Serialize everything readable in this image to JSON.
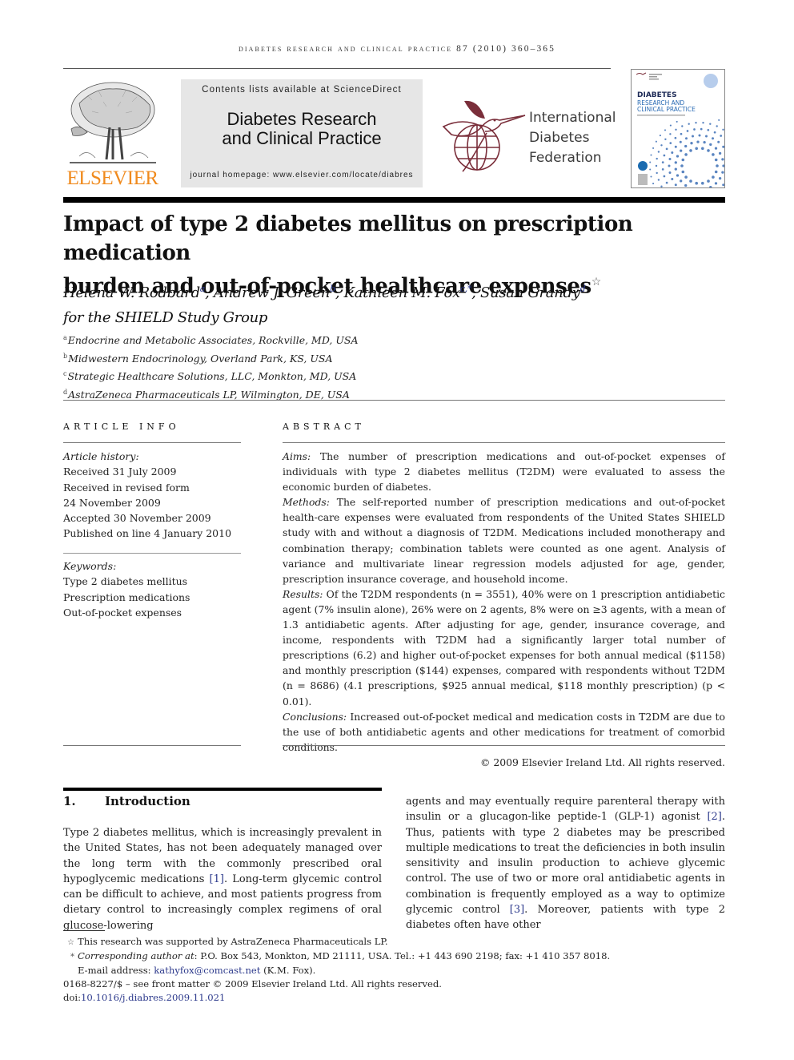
{
  "running_head": "DIABETES RESEARCH AND CLINICAL PRACTICE 87 (2010) 360–365",
  "masthead": {
    "publisher_logo_text": "ELSEVIER",
    "contents_line": "Contents lists available at ScienceDirect",
    "journal_title_line1": "Diabetes Research",
    "journal_title_line2": "and Clinical Practice",
    "homepage_line": "journal homepage: www.elsevier.com/locate/diabres",
    "idf_line1": "International",
    "idf_line2": "Diabetes",
    "idf_line3": "Federation",
    "cover_title": "DIABETES",
    "cover_sub1": "RESEARCH AND",
    "cover_sub2": "CLINICAL PRACTICE"
  },
  "article": {
    "title_line1": "Impact of type 2 diabetes mellitus on prescription medication",
    "title_line2": "burden and out-of-pocket healthcare expenses",
    "title_mark": "☆",
    "authors": [
      {
        "name": "Helena W. Rodbard",
        "sup": "a"
      },
      {
        "name": "Andrew J. Green",
        "sup": "b"
      },
      {
        "name": "Kathleen M. Fox",
        "sup": "c,*"
      },
      {
        "name": "Susan Grandy",
        "sup": "d"
      }
    ],
    "group": "for the SHIELD Study Group",
    "affiliations": [
      {
        "sup": "a",
        "text": "Endocrine and Metabolic Associates, Rockville, MD, USA"
      },
      {
        "sup": "b",
        "text": "Midwestern Endocrinology, Overland Park, KS, USA"
      },
      {
        "sup": "c",
        "text": "Strategic Healthcare Solutions, LLC, Monkton, MD, USA"
      },
      {
        "sup": "d",
        "text": "AstraZeneca Pharmaceuticals LP, Wilmington, DE, USA"
      }
    ]
  },
  "article_info": {
    "heading": "ARTICLE INFO",
    "history_label": "Article history:",
    "history": [
      "Received 31 July 2009",
      "Received in revised form",
      "24 November 2009",
      "Accepted 30 November 2009",
      "Published on line 4 January 2010"
    ],
    "keywords_label": "Keywords:",
    "keywords": [
      "Type 2 diabetes mellitus",
      "Prescription medications",
      "Out-of-pocket expenses"
    ]
  },
  "abstract": {
    "heading": "ABSTRACT",
    "aims_label": "Aims:",
    "aims": "The number of prescription medications and out-of-pocket expenses of individuals with type 2 diabetes mellitus (T2DM) were evaluated to assess the economic burden of diabetes.",
    "methods_label": "Methods:",
    "methods": "The self-reported number of prescription medications and out-of-pocket health-care expenses were evaluated from respondents of the United States SHIELD study with and without a diagnosis of T2DM. Medications included monotherapy and combination therapy; combination tablets were counted as one agent. Analysis of variance and multivariate linear regression models adjusted for age, gender, prescription insurance coverage, and household income.",
    "results_label": "Results:",
    "results": "Of the T2DM respondents (n = 3551), 40% were on 1 prescription antidiabetic agent (7% insulin alone), 26% were on 2 agents, 8% were on ≥3 agents, with a mean of 1.3 antidiabetic agents. After adjusting for age, gender, insurance coverage, and income, respondents with T2DM had a significantly larger total number of prescriptions (6.2) and higher out-of-pocket expenses for both annual medical ($1158) and monthly prescription ($144) expenses, compared with respondents without T2DM (n = 8686) (4.1 prescriptions, $925 annual medical, $118 monthly prescription) (p < 0.01).",
    "conclusions_label": "Conclusions:",
    "conclusions": "Increased out-of-pocket medical and medication costs in T2DM are due to the use of both antidiabetic agents and other medications for treatment of comorbid conditions.",
    "copyright": "© 2009 Elsevier Ireland Ltd. All rights reserved."
  },
  "introduction": {
    "number": "1.",
    "heading": "Introduction",
    "left_a": "Type 2 diabetes mellitus, which is increasingly prevalent in the United States, has not been adequately managed over the long term with the commonly prescribed oral hypoglycemic medications ",
    "left_ref1": "[1]",
    "left_b": ". Long-term glycemic control can be difficult to achieve, and most patients progress from dietary control to increasingly complex regimens of oral glucose-lowering",
    "right_a": "agents and may eventually require parenteral therapy with insulin or a glucagon-like peptide-1 (GLP-1) agonist ",
    "right_ref2": "[2]",
    "right_b": ". Thus, patients with type 2 diabetes may be prescribed multiple medications to treat the deficiencies in both insulin sensitivity and insulin production to achieve glycemic control. The use of two or more oral antidiabetic agents in combination is frequently employed as a way to optimize glycemic control ",
    "right_ref3": "[3]",
    "right_c": ". Moreover, patients with type 2 diabetes often have other"
  },
  "footnotes": {
    "star_mark": "☆",
    "funding": "This research was supported by AstraZeneca Pharmaceuticals LP.",
    "corr_mark": "*",
    "corr_label": "Corresponding author at",
    "corr_text": ": P.O. Box 543, Monkton, MD 21111, USA. Tel.: +1 443 690 2198; fax: +1 410 357 8018.",
    "email_label": "E-mail address: ",
    "email": "kathyfox@comcast.net",
    "email_suffix": " (K.M. Fox).",
    "issn_line": "0168-8227/$ – see front matter © 2009 Elsevier Ireland Ltd. All rights reserved.",
    "doi_label": "doi:",
    "doi": "10.1016/j.diabres.2009.11.021"
  }
}
